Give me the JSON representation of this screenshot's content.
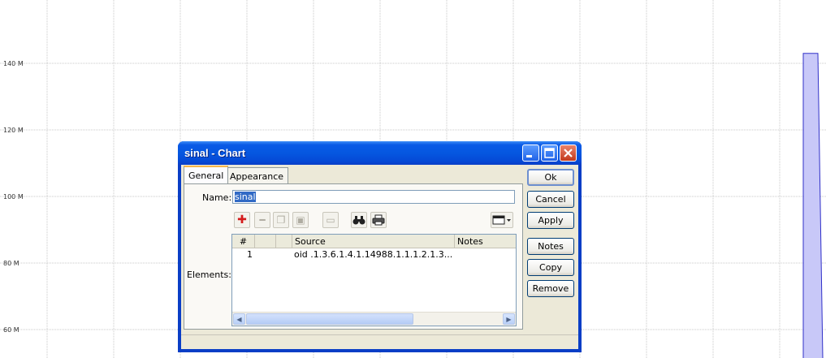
{
  "chart": {
    "y_ticks": [
      {
        "label": "140 M",
        "value": 140
      },
      {
        "label": "120 M",
        "value": 120
      },
      {
        "label": "100 M",
        "value": 100
      },
      {
        "label": "80 M",
        "value": 80
      },
      {
        "label": "60 M",
        "value": 60
      }
    ],
    "grid_color": "#c8c8c8",
    "series_fill": "#c8c8f8",
    "series_stroke": "#3030c8",
    "bar_value": 143
  },
  "dialog": {
    "title": "sinal - Chart",
    "tabs": [
      {
        "label": "General",
        "active": true
      },
      {
        "label": "Appearance",
        "active": false
      }
    ],
    "name_label": "Name:",
    "name_value": "sinal",
    "elements_label": "Elements:",
    "toolbar": [
      {
        "icon": "plus-icon",
        "glyph": "✚",
        "enabled": true
      },
      {
        "icon": "minus-icon",
        "glyph": "━",
        "enabled": false
      },
      {
        "icon": "copy-icon",
        "glyph": "❐",
        "enabled": false
      },
      {
        "icon": "paste-icon",
        "glyph": "▣",
        "enabled": false
      },
      {
        "icon": "comment-icon",
        "glyph": "▭",
        "enabled": false
      },
      {
        "icon": "find-icon",
        "glyph": "👓",
        "enabled": true
      },
      {
        "icon": "print-icon",
        "glyph": "⎙",
        "enabled": true
      }
    ],
    "columns_menu_icon": "window-layout-icon",
    "grid": {
      "headers": [
        "#",
        "",
        "",
        "Source",
        "Notes"
      ],
      "rows": [
        {
          "num": "1",
          "source": "oid .1.3.6.1.4.1.14988.1.1.1.2.1.3...",
          "notes": ""
        }
      ]
    },
    "buttons": [
      "Ok",
      "Cancel",
      "Apply",
      "Notes",
      "Copy",
      "Remove"
    ],
    "colors": {
      "title_bar": "#0557e0",
      "window_bg": "#ece9d8",
      "close_button": "#c3391c"
    }
  }
}
